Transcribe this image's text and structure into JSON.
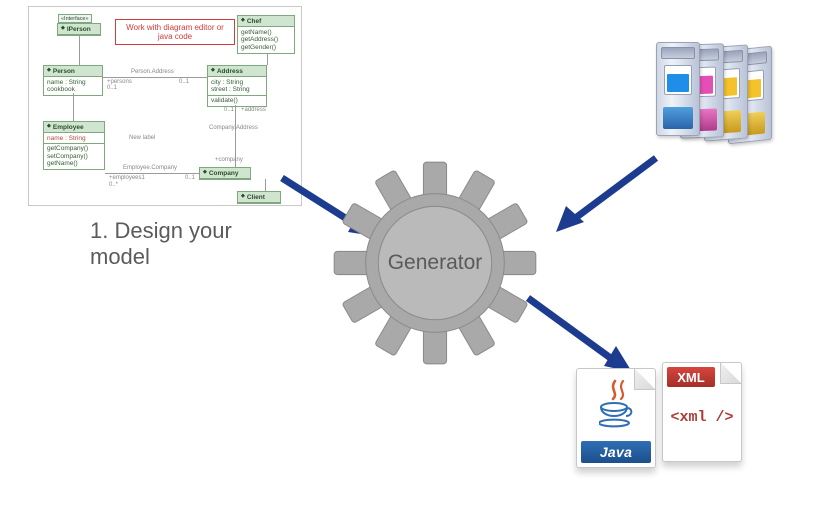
{
  "step_label": "1. Design your model",
  "uml": {
    "hint": "Work with diagram editor or java code",
    "interface": {
      "name": "IPerson",
      "tag": "«Interface»"
    },
    "chef": {
      "name": "Chef",
      "ops": [
        "getName()",
        "getAddress()",
        "getGender()"
      ]
    },
    "person": {
      "name": "Person",
      "attrs": [
        "name : String",
        "cookbook"
      ]
    },
    "address": {
      "name": "Address",
      "attrs": [
        "city : String",
        "street : String"
      ],
      "ops": [
        "validate()"
      ]
    },
    "employee": {
      "name": "Employee",
      "attrs": [
        "name : String"
      ],
      "ops": [
        "getCompany()",
        "setCompany()",
        "getName()"
      ]
    },
    "company": {
      "name": "Company"
    },
    "client": {
      "name": "Client"
    },
    "labels": {
      "person_address": "Person.Address",
      "company_address": "Company.Address",
      "employee_company": "Employee.Company",
      "new_label": "New label",
      "persons": "+persons",
      "employees": "+employees1",
      "company": "+company",
      "address": "+address",
      "m01a": "0..1",
      "m01b": "0..1",
      "m01c": "0..1",
      "m01d": "0..1",
      "m0n": "0..*"
    }
  },
  "generator_label": "Generator",
  "cartridges": [
    {
      "ink": "#1f8ee8",
      "label": "#2b64a8"
    },
    {
      "ink": "#e54fb5",
      "label": "#b13a8a"
    },
    {
      "ink": "#f4c22a",
      "label": "#c79a1e"
    },
    {
      "ink": "#f4c22a",
      "label": "#c79a1e"
    }
  ],
  "outputs": {
    "java_label": "Java",
    "xml_head": "XML",
    "xml_body": "<xml />"
  },
  "colors": {
    "arrow": "#1d3b8f"
  }
}
